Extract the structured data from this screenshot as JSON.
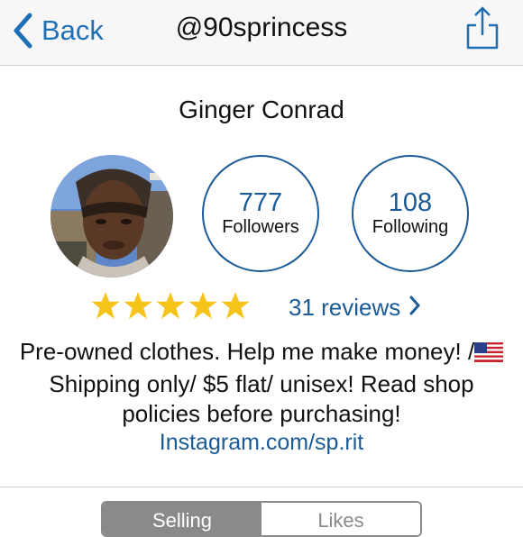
{
  "nav": {
    "back_label": "Back",
    "title": "@90sprincess",
    "back_icon": "chevron-left-icon",
    "share_icon": "share-icon"
  },
  "profile": {
    "name": "Ginger Conrad",
    "followers": {
      "count": "777",
      "label": "Followers"
    },
    "following": {
      "count": "108",
      "label": "Following"
    },
    "rating": 5,
    "reviews_label": "31 reviews",
    "bio_part1": "Pre-owned clothes. Help me make money! /",
    "bio_part2": "Shipping only/ $5 flat/ unisex! Read shop policies before purchasing!",
    "bio_link": "Instagram.com/sp.rit"
  },
  "tabs": [
    {
      "label": "Selling",
      "active": true
    },
    {
      "label": "Likes",
      "active": false
    }
  ],
  "colors": {
    "accent": "#1a5a96",
    "link": "#1f6fb5",
    "star": "#f6c319",
    "nav_bg": "#f7f7f7"
  }
}
